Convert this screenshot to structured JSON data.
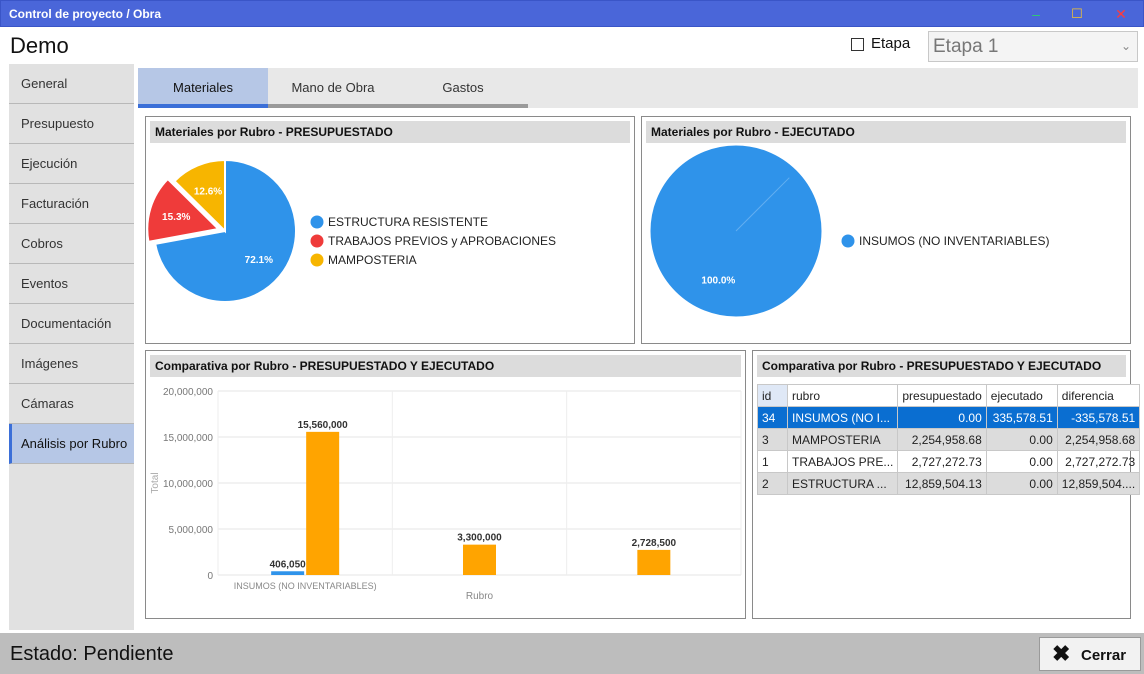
{
  "window": {
    "title": "Control de proyecto / Obra",
    "minimize": "–",
    "maximize": "☐",
    "close": "✕"
  },
  "header": {
    "project": "Demo",
    "etapa_label": "Etapa",
    "etapa_value": "Etapa 1",
    "chevron": "⌄"
  },
  "sidebar": {
    "items": [
      {
        "label": "General"
      },
      {
        "label": "Presupuesto"
      },
      {
        "label": "Ejecución"
      },
      {
        "label": "Facturación"
      },
      {
        "label": "Cobros"
      },
      {
        "label": "Eventos"
      },
      {
        "label": "Documentación"
      },
      {
        "label": "Imágenes"
      },
      {
        "label": "Cámaras"
      },
      {
        "label": "Análisis por Rubro",
        "active": true
      }
    ]
  },
  "tabs": [
    {
      "label": "Materiales",
      "active": true
    },
    {
      "label": "Mano de Obra"
    },
    {
      "label": "Gastos"
    }
  ],
  "panels": {
    "pie1_title": "Materiales por Rubro - PRESUPUESTADO",
    "pie2_title": "Materiales por Rubro - EJECUTADO",
    "bar_title": "Comparativa por Rubro - PRESUPUESTADO Y EJECUTADO",
    "table_title": "Comparativa por Rubro - PRESUPUESTADO Y EJECUTADO"
  },
  "chart_data": [
    {
      "type": "pie",
      "title": "Materiales por Rubro - PRESUPUESTADO",
      "slices": [
        {
          "label": "ESTRUCTURA RESISTENTE",
          "value": 72.1,
          "text": "72.1%",
          "color": "#2f93ea"
        },
        {
          "label": "TRABAJOS PREVIOS y APROBACIONES",
          "value": 15.3,
          "text": "15.3%",
          "color": "#ef3b3a",
          "exploded": true
        },
        {
          "label": "MAMPOSTERIA",
          "value": 12.6,
          "text": "12.6%",
          "color": "#f7b500"
        }
      ]
    },
    {
      "type": "pie",
      "title": "Materiales por Rubro - EJECUTADO",
      "slices": [
        {
          "label": "INSUMOS (NO INVENTARIABLES)",
          "value": 100.0,
          "text": "100.0%",
          "color": "#2f93ea"
        }
      ]
    },
    {
      "type": "bar",
      "title": "Comparativa por Rubro - PRESUPUESTADO Y EJECUTADO",
      "xlabel": "Rubro",
      "ylabel": "Total",
      "ylim": [
        0,
        20000000
      ],
      "yticks": [
        "0",
        "5,000,000",
        "10,000,000",
        "15,000,000",
        "20,000,000"
      ],
      "categories": [
        "INSUMOS (NO INVENTARIABLES)",
        "",
        ""
      ],
      "series": [
        {
          "color": "#2f93ea",
          "values": [
            406050,
            null,
            null
          ],
          "labels": [
            "406,050",
            "",
            ""
          ]
        },
        {
          "color": "#ffa400",
          "values": [
            15560000,
            3300000,
            2728500
          ],
          "labels": [
            "15,560,000",
            "3,300,000",
            "2,728,500"
          ]
        }
      ],
      "grid": true
    }
  ],
  "table": {
    "columns": [
      "id",
      "rubro",
      "presupuestado",
      "ejecutado",
      "diferencia"
    ],
    "rows": [
      [
        "34",
        "INSUMOS (NO I...",
        "0.00",
        "335,578.51",
        "-335,578.51"
      ],
      [
        "3",
        "MAMPOSTERIA",
        "2,254,958.68",
        "0.00",
        "2,254,958.68"
      ],
      [
        "1",
        "TRABAJOS PRE...",
        "2,727,272.73",
        "0.00",
        "2,727,272.73"
      ],
      [
        "2",
        "ESTRUCTURA ...",
        "12,859,504.13",
        "0.00",
        "12,859,504...."
      ]
    ]
  },
  "footer": {
    "status": "Estado: Pendiente",
    "close_icon": "✖",
    "close_label": "Cerrar"
  },
  "colors": {
    "titlebar": "#4a66d9",
    "accent": "#0a6ed1",
    "active_tab": "#b6c7e6"
  }
}
